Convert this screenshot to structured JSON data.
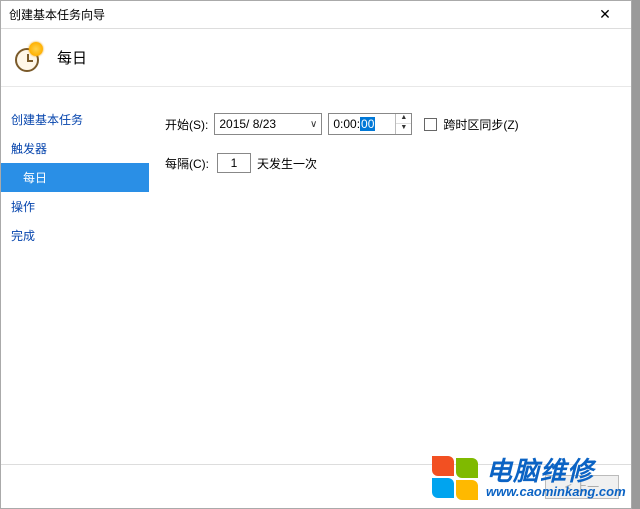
{
  "window": {
    "title": "创建基本任务向导"
  },
  "header": {
    "title": "每日"
  },
  "sidebar": {
    "items": [
      {
        "label": "创建基本任务",
        "level": 1,
        "active": false
      },
      {
        "label": "触发器",
        "level": 1,
        "active": false
      },
      {
        "label": "每日",
        "level": 2,
        "active": true
      },
      {
        "label": "操作",
        "level": 1,
        "active": false
      },
      {
        "label": "完成",
        "level": 1,
        "active": false
      }
    ]
  },
  "form": {
    "start_label": "开始(S):",
    "date_value": "2015/ 8/23",
    "time_prefix": "0:00:",
    "time_selected": "00",
    "sync_label": "跨时区同步(Z)",
    "sync_checked": false,
    "interval_label": "每隔(C):",
    "interval_value": "1",
    "interval_suffix": "天发生一次"
  },
  "footer": {
    "back_label": "< 上一"
  },
  "watermark": {
    "line1": "电脑维修",
    "line2": "www.caominkang.com"
  }
}
